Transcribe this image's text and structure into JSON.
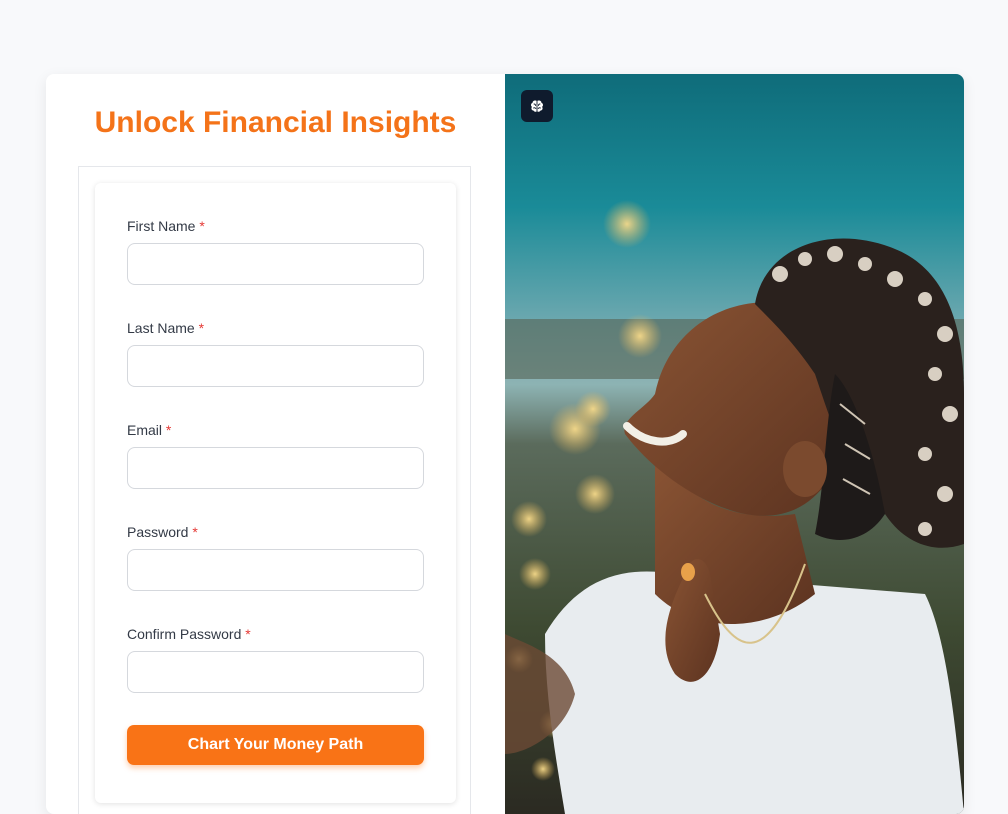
{
  "form": {
    "title": "Unlock Financial Insights",
    "required_marker": "*",
    "fields": [
      {
        "label": "First Name",
        "value": "",
        "placeholder": ""
      },
      {
        "label": "Last Name",
        "value": "",
        "placeholder": ""
      },
      {
        "label": "Email",
        "value": "",
        "placeholder": ""
      },
      {
        "label": "Password",
        "value": "",
        "placeholder": ""
      },
      {
        "label": "Confirm Password",
        "value": "",
        "placeholder": ""
      }
    ],
    "submit_label": "Chart Your Money Path"
  },
  "hero": {
    "icon": "brain-icon",
    "photo": "woman-smiling-outdoors-photo"
  },
  "colors": {
    "accent": "#f97316",
    "title": "#f47319",
    "required": "#e53935",
    "page_bg": "#f8f9fb",
    "badge_bg": "#0f1b2d"
  }
}
